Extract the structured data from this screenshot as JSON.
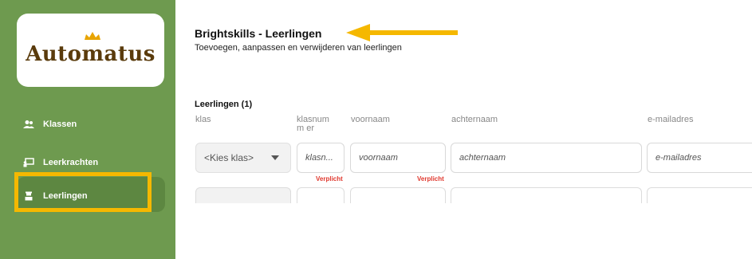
{
  "sidebar": {
    "logo_text": "Automatus",
    "items": [
      {
        "label": "Klassen",
        "icon": "users-icon"
      },
      {
        "label": "Leerkrachten",
        "icon": "teacher-board-icon"
      },
      {
        "label": "Leerlingen",
        "icon": "student-icon"
      }
    ]
  },
  "header": {
    "title": "Brightskills - Leerlingen",
    "subtitle": "Toevoegen, aanpassen en verwijderen van leerlingen"
  },
  "section": {
    "title": "Leerlingen (1)",
    "columns": [
      "klas",
      "klasnumm er",
      "voornaam",
      "achternaam",
      "e-mailadres"
    ]
  },
  "form": {
    "class_select_value": "<Kies klas>",
    "placeholders": {
      "klasnummer": "klasn...",
      "voornaam": "voornaam",
      "achternaam": "achternaam",
      "email": "e-mailadres"
    },
    "required_label": "Verplicht"
  },
  "colors": {
    "sidebar": "#6e9a4f",
    "highlight": "#f5b800",
    "required": "#e0382e"
  }
}
